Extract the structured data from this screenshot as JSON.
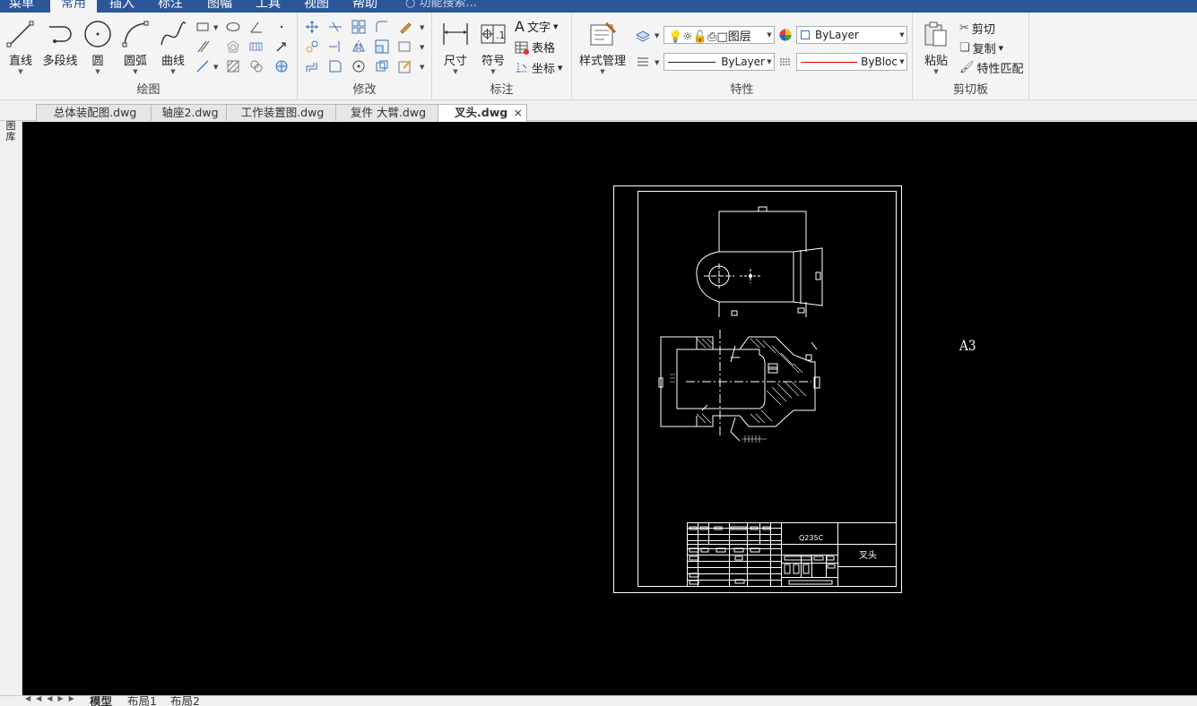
{
  "menu": {
    "tabs": [
      "菜单",
      "常用",
      "插入",
      "标注",
      "图幅",
      "工具",
      "视图",
      "帮助"
    ],
    "active_tab": "常用",
    "search_placeholder": "功能搜索..."
  },
  "ribbon": {
    "draw": {
      "label": "绘图",
      "line": "直线",
      "polyline": "多段线",
      "circle": "圆",
      "arc": "圆弧",
      "spline": "曲线"
    },
    "modify": {
      "label": "修改"
    },
    "annotate": {
      "label": "标注",
      "dimension": "尺寸",
      "symbol": "符号",
      "text": "文字",
      "table": "表格",
      "coordinate": "坐标"
    },
    "properties": {
      "label": "特性",
      "style_manager": "样式管理",
      "layer": "图层",
      "color_value": "ByLayer",
      "linetype_value": "ByLayer",
      "lineweight_value": "ByBloc"
    },
    "clipboard": {
      "label": "剪切板",
      "paste": "粘贴",
      "cut": "剪切",
      "copy": "复制",
      "match_properties": "特性匹配"
    }
  },
  "document_tabs": [
    {
      "label": "总体装配图.dwg"
    },
    {
      "label": "轴座2.dwg"
    },
    {
      "label": "工作装置图.dwg"
    },
    {
      "label": "复件 大臂.dwg"
    },
    {
      "label": "叉头.dwg"
    }
  ],
  "active_document": "叉头.dwg",
  "close_glyph": "×",
  "left_panel_label": "图库",
  "drawing": {
    "sheet_label": "A3",
    "title_block_material": "Q235C",
    "title_block_name": "叉头"
  },
  "layout_tabs": [
    "模型",
    "布局1",
    "布局2"
  ],
  "active_layout": "模型",
  "colors": {
    "accent": "#2b579a",
    "canvas": "#000000",
    "ribbon": "#f4f4f4",
    "lineweight_line": "#e00000"
  }
}
